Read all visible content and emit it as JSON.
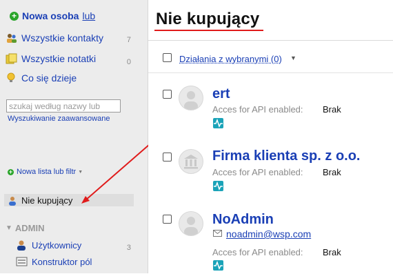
{
  "sidebar": {
    "new_person": "Nowa osoba",
    "or": "lub",
    "items": [
      {
        "label": "Wszystkie kontakty",
        "count": "7",
        "icon": "contacts-icon"
      },
      {
        "label": "Wszystkie notatki",
        "count": "0",
        "icon": "notes-icon"
      },
      {
        "label": "Co się dzieje",
        "count": "",
        "icon": "activity-icon"
      }
    ],
    "search_placeholder": "szukaj według nazwy lub",
    "advanced_search": "Wyszukiwanie zaawansowane",
    "new_list": "Nowa lista lub filtr",
    "selected_list": "Nie kupujący",
    "admin_section": "ADMIN",
    "admin_items": [
      {
        "label": "Użytkownicy",
        "count": "3"
      },
      {
        "label": "Konstruktor pól",
        "count": ""
      }
    ]
  },
  "main": {
    "title": "Nie kupujący",
    "bulk_actions": "Działania z wybranymi (0)",
    "contacts": [
      {
        "name": "ert",
        "api_label": "Acces for API enabled:",
        "api_value": "Brak",
        "email": "",
        "avatar": "person-avatar"
      },
      {
        "name": "Firma klienta sp. z o.o.",
        "api_label": "Acces for API enabled:",
        "api_value": "Brak",
        "email": "",
        "avatar": "company-avatar"
      },
      {
        "name": "NoAdmin",
        "api_label": "Acces for API enabled:",
        "api_value": "Brak",
        "email": "noadmin@wsp.com",
        "avatar": "person-avatar"
      }
    ]
  },
  "colors": {
    "link": "#1a3fb5",
    "highlight": "#e01b1b",
    "accent": "#1aa3b8"
  }
}
